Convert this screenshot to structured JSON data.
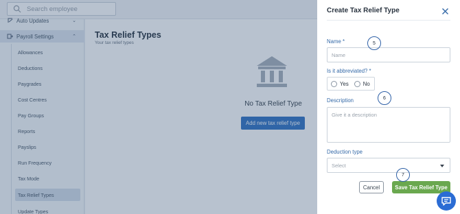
{
  "background": {
    "search": {
      "placeholder": "Search employee"
    },
    "sidebar": {
      "auto_updates": "Auto Updates",
      "section": "Payroll Settings",
      "items": [
        {
          "label": "Allowances"
        },
        {
          "label": "Deductions"
        },
        {
          "label": "Paygrades"
        },
        {
          "label": "Cost Centres"
        },
        {
          "label": "Pay Groups"
        },
        {
          "label": "Reports"
        },
        {
          "label": "Payslips"
        },
        {
          "label": "Run Frequency"
        },
        {
          "label": "Tax Mode"
        },
        {
          "label": "Tax Relief Types"
        },
        {
          "label": "Update Types"
        }
      ],
      "active_item": "Tax Relief Types"
    },
    "main": {
      "title": "Tax Relief Types",
      "subtitle": "Your tax relief types",
      "empty_text": "No Tax Relief Type",
      "add_button": "Add new tax relief type"
    }
  },
  "panel": {
    "title": "Create Tax Relief Type",
    "name": {
      "label": "Name *",
      "placeholder": "Name"
    },
    "abbreviated": {
      "label": "Is it abbreviated? *",
      "yes": "Yes",
      "no": "No"
    },
    "description": {
      "label": "Description",
      "placeholder": "Give it a description"
    },
    "deduction_type": {
      "label": "Deduction type",
      "placeholder": "Select"
    },
    "cancel_button": "Cancel",
    "save_button": "Save Tax Relief Type"
  },
  "steps": {
    "name": "5",
    "description": "6",
    "save": "7"
  },
  "colors": {
    "accent": "#3575c4",
    "label_blue": "#356aa8",
    "save_green": "#6aa84f",
    "chat_blue": "#2b6cd4"
  },
  "icons": [
    "search-icon",
    "auto-updates-icon",
    "payroll-settings-icon",
    "chevron-up-icon",
    "bank-icon",
    "close-icon",
    "chevron-down-icon",
    "chat-icon"
  ]
}
